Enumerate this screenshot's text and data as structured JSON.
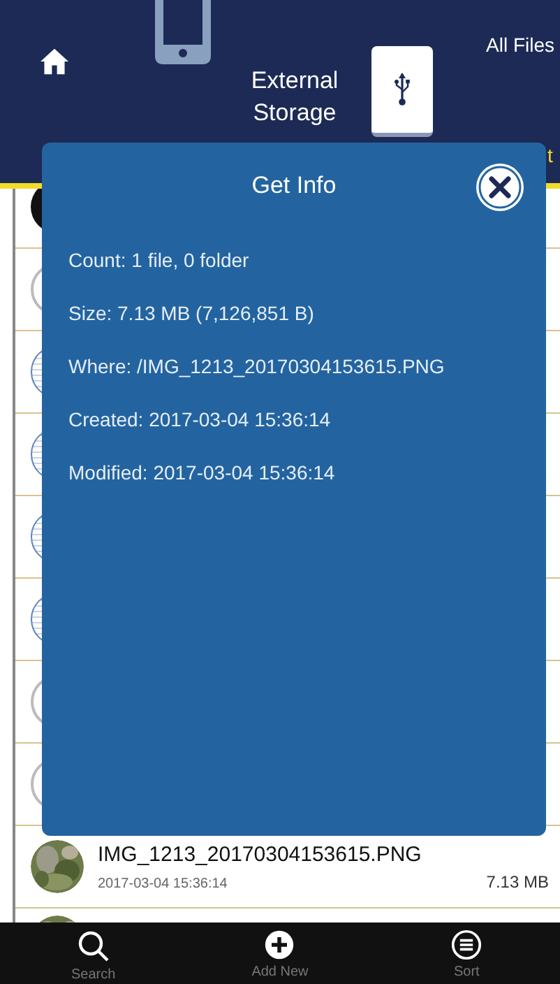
{
  "header": {
    "storage_label": "External Storage",
    "right_label": "All Files",
    "cut_label": "t"
  },
  "list": {
    "rows": [
      {
        "kind": "dark"
      },
      {
        "kind": "outline"
      },
      {
        "kind": "globe"
      },
      {
        "kind": "globe"
      },
      {
        "kind": "globe"
      },
      {
        "kind": "globe"
      },
      {
        "kind": "outline"
      },
      {
        "kind": "outline"
      },
      {
        "kind": "file",
        "name": "IMG_1213_20170304153615.PNG",
        "date": "2017-03-04 15:36:14",
        "size": "7.13 MB"
      },
      {
        "kind": "picture"
      }
    ]
  },
  "dialog": {
    "title": "Get Info",
    "lines": [
      "Count: 1 file, 0 folder",
      "Size: 7.13 MB (7,126,851 B)",
      "Where: /IMG_1213_20170304153615.PNG",
      "Created: 2017-03-04 15:36:14",
      "Modified: 2017-03-04 15:36:14"
    ]
  },
  "tab_bar": [
    {
      "kind": "search",
      "label": "Search"
    },
    {
      "kind": "add",
      "label": "Add New"
    },
    {
      "kind": "sort",
      "label": "Sort"
    }
  ]
}
